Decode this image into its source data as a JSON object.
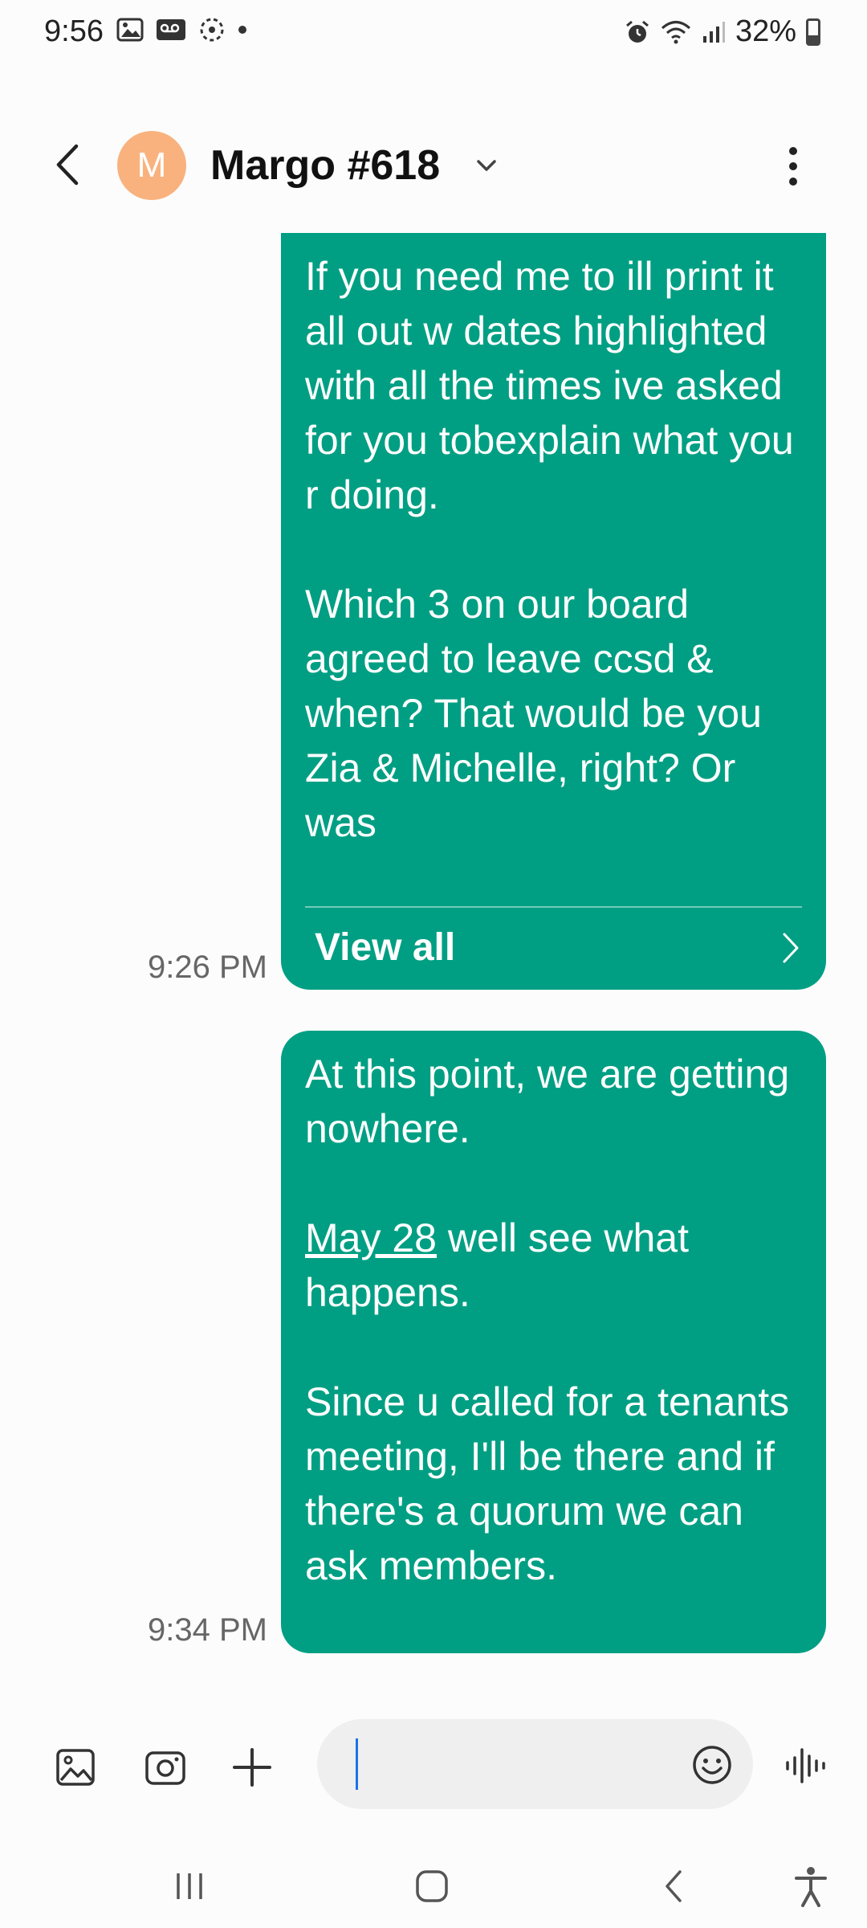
{
  "status_bar": {
    "time": "9:56",
    "battery": "32%"
  },
  "header": {
    "avatar_initial": "M",
    "contact_name": "Margo #618"
  },
  "messages": [
    {
      "text": "If you need me to ill print it all out w dates highlighted with all the times ive asked for you tobexplain what you r doing.\n\nWhich 3 on our board agreed to leave ccsd & when? That would be you Zia & Michelle, right? Or was",
      "view_all_label": "View all",
      "time": "9:26 PM"
    },
    {
      "text_part1": "At this point, we are getting nowhere.\n\n",
      "link_text": "May 28",
      "text_part2": " well see what happens.\n\nSince u called for a tenants meeting, I'll be there and if there's a quorum we can ask members.",
      "time": "9:34 PM"
    }
  ],
  "colors": {
    "bubble": "#009f83",
    "avatar": "#f9b27e"
  }
}
